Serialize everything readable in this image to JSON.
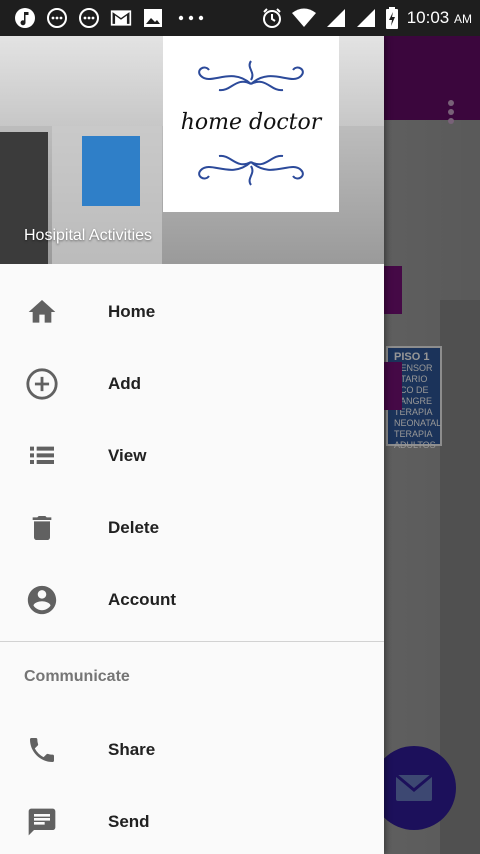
{
  "status_bar": {
    "time": "10:03",
    "ampm": "AM",
    "icons_left": [
      "music-icon",
      "message-icon",
      "message-icon",
      "gmail-icon",
      "image-icon",
      "more-dots-icon"
    ],
    "icons_right": [
      "alarm-icon",
      "wifi-icon",
      "signal-icon",
      "signal-icon",
      "battery-icon"
    ]
  },
  "drawer": {
    "header": {
      "logo_text": "home doctor",
      "subtitle": "Hosipital Activities"
    },
    "items": [
      {
        "label": "Home",
        "icon": "home-icon"
      },
      {
        "label": "Add",
        "icon": "add-circle-icon"
      },
      {
        "label": "View",
        "icon": "list-icon"
      },
      {
        "label": "Delete",
        "icon": "trash-icon"
      },
      {
        "label": "Account",
        "icon": "account-circle-icon"
      }
    ],
    "section_title": "Communicate",
    "communicate_items": [
      {
        "label": "Share",
        "icon": "phone-icon"
      },
      {
        "label": "Send",
        "icon": "message-icon"
      }
    ]
  },
  "background_app": {
    "sign_text": "PISO 1",
    "sign_lines": [
      "CENSOR",
      "NTARIO",
      "ACO DE SANGRE",
      "TERAPIA NEONATAL",
      "TERAPIA ADULTOS"
    ]
  },
  "colors": {
    "toolbar": "#5b0a5e",
    "fab": "#2b1a8c",
    "drawer_bg": "#fafafa",
    "icon_gray": "#616161"
  }
}
